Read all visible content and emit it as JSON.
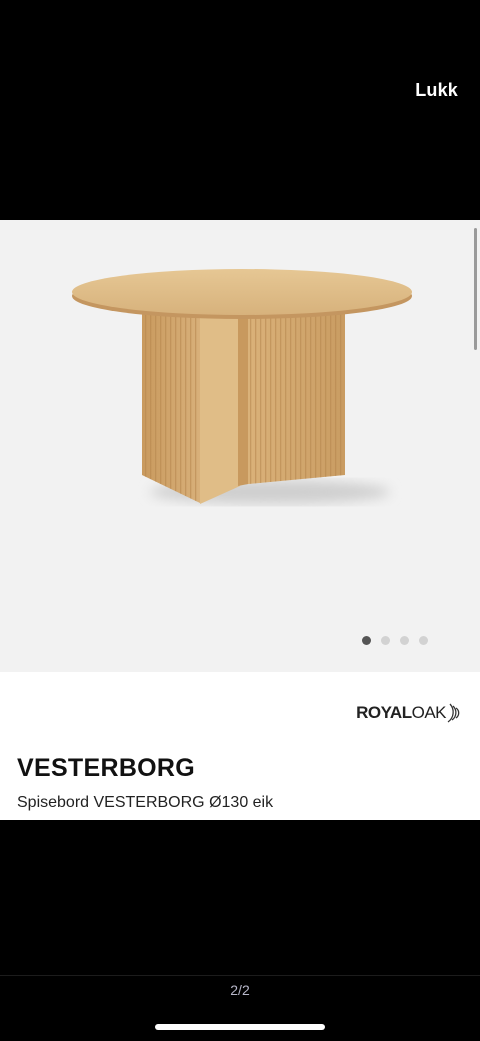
{
  "header": {
    "close_label": "Lukk"
  },
  "gallery": {
    "image_alt": "Spisebord VESTERBORG Ø130 eik",
    "dot_count": 4,
    "active_dot_index": 0
  },
  "product": {
    "brand": {
      "part1": "ROYAL",
      "part2": "OAK"
    },
    "title": "VESTERBORG",
    "subtitle": "Spisebord VESTERBORG Ø130 eik"
  },
  "pager": {
    "text": "2/2"
  },
  "colors": {
    "background": "#000000",
    "card": "#ffffff",
    "image_bg": "#f2f2f2",
    "wood": "#d9b47e"
  }
}
